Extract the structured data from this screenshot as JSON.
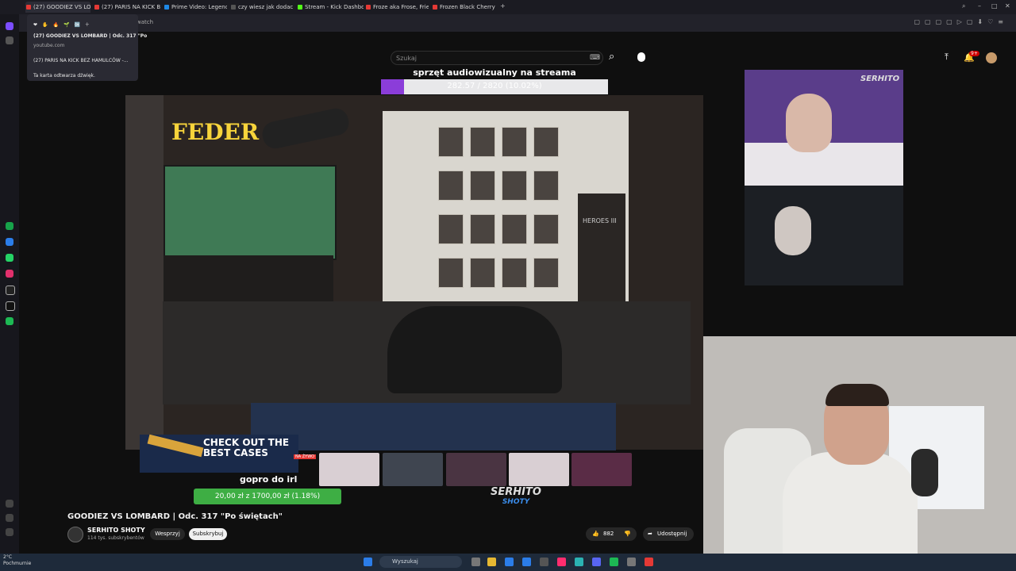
{
  "browser": {
    "tabs": [
      {
        "label": "(27) GOODIEZ VS LOM",
        "color": "#e53935",
        "active": true
      },
      {
        "label": "(27) PARIS NA KICK BEZ H",
        "color": "#e53935"
      },
      {
        "label": "Prime Video: Legend",
        "color": "#1e88e5"
      },
      {
        "label": "czy wiesz jak dodac link z",
        "color": "#333333"
      },
      {
        "label": "Stream - Kick Dashboard",
        "color": "#53fc18"
      },
      {
        "label": "Froze aka Frose, Frieza W",
        "color": "#e53935"
      },
      {
        "label": "Frozen Black Cherry - AN",
        "color": "#e53935"
      }
    ],
    "address_fragment": "watch",
    "tab_popup": {
      "item1_title": "(27) GOODIEZ VS LOMBARD | Odc. 317 \"Po",
      "item1_site": "youtube.com",
      "item2_title": "(27) PARIS NA KICK BEZ HAMULCÓW -...",
      "footer": "Ta karta odtwarza dźwięk."
    }
  },
  "youtube": {
    "search_placeholder": "Szukaj",
    "notification_badge": "9+",
    "video": {
      "title": "GOODIEZ VS LOMBARD | Odc. 317 \"Po świętach\"",
      "channel": "SERHITO SHOTY",
      "subscribers": "114 tys. subskrybentów",
      "join_label": "Wesprzyj",
      "subscribe_label": "Subskrybuj",
      "likes": "882",
      "share_label": "Udostępnij"
    },
    "overlay": {
      "goal_title": "sprzęt audiowizualny na streama",
      "goal_progress_text": "282.57 / 2820 (10.02%)",
      "goal_fraction": 0.1002,
      "cases_banner": "CHECK OUT THE BEST CASES",
      "cases_live_badge": "NA ŻYWO",
      "irl_text": "gopro do irl",
      "donation_text": "20,00 zł z 1700,00 zł (1.18%)",
      "donation_fraction": 0.0118,
      "watermark_top": "SERHITO",
      "watermark_bottom": "SHOTY",
      "poster_text": "HEROES III",
      "neon_text": "FEDER"
    }
  },
  "taskbar": {
    "weather_temp": "2°C",
    "weather_desc": "Pochmurnie",
    "search_placeholder": "Wyszukaj"
  },
  "colors": {
    "accent_purple": "#8b3dd9",
    "donation_green": "#3eae44",
    "youtube_red": "#ff0000"
  }
}
